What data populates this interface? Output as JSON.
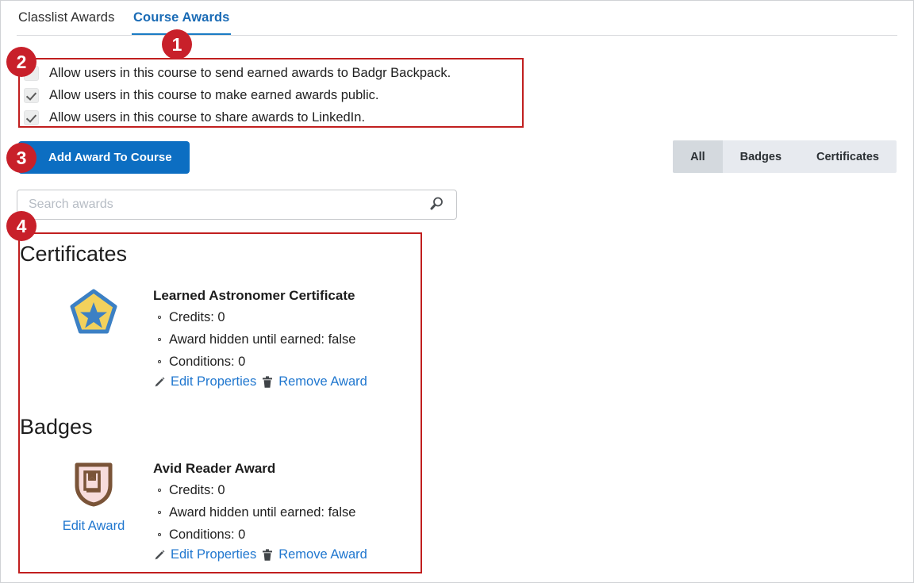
{
  "tabs": [
    {
      "label": "Classlist Awards",
      "active": false
    },
    {
      "label": "Course Awards",
      "active": true
    }
  ],
  "options": {
    "items": [
      {
        "label": "Allow users in this course to send earned awards to Badgr Backpack.",
        "checked": false
      },
      {
        "label": "Allow users in this course to make earned awards public.",
        "checked": true
      },
      {
        "label": "Allow users in this course to share awards to LinkedIn.",
        "checked": true
      }
    ]
  },
  "toolbar": {
    "add_award_label": "Add Award To Course",
    "filters": [
      {
        "label": "All",
        "selected": true
      },
      {
        "label": "Badges",
        "selected": false
      },
      {
        "label": "Certificates",
        "selected": false
      }
    ]
  },
  "search": {
    "placeholder": "Search awards",
    "value": "",
    "icon": "search-icon"
  },
  "awards": {
    "sections": [
      {
        "title": "Certificates",
        "items": [
          {
            "name": "Learned Astronomer Certificate",
            "icon": "pentagon-star-certificate-icon",
            "facts": [
              "Credits: 0",
              "Award hidden until earned: false",
              "Conditions: 0"
            ],
            "edit_award_label": "",
            "actions": [
              {
                "label": "Edit Properties",
                "icon": "pencil-icon"
              },
              {
                "label": "Remove Award",
                "icon": "trash-icon"
              }
            ]
          }
        ]
      },
      {
        "title": "Badges",
        "items": [
          {
            "name": "Avid Reader Award",
            "icon": "shield-book-badge-icon",
            "facts": [
              "Credits: 0",
              "Award hidden until earned: false",
              "Conditions: 0"
            ],
            "edit_award_label": "Edit Award",
            "actions": [
              {
                "label": "Edit Properties",
                "icon": "pencil-icon"
              },
              {
                "label": "Remove Award",
                "icon": "trash-icon"
              }
            ]
          }
        ]
      }
    ]
  },
  "callouts": [
    {
      "number": "1"
    },
    {
      "number": "2"
    },
    {
      "number": "3"
    },
    {
      "number": "4"
    }
  ],
  "colors": {
    "accent_blue": "#0c6ec2",
    "link_blue": "#2077cf",
    "tab_active_blue": "#1a6bb5",
    "callout_red": "#c8202a",
    "annotation_red": "#c11f1f",
    "certificate_fill": "#f2d15c",
    "certificate_stroke": "#3c80c4",
    "badge_stroke": "#7a5438",
    "badge_fill": "#f7dcdc"
  }
}
